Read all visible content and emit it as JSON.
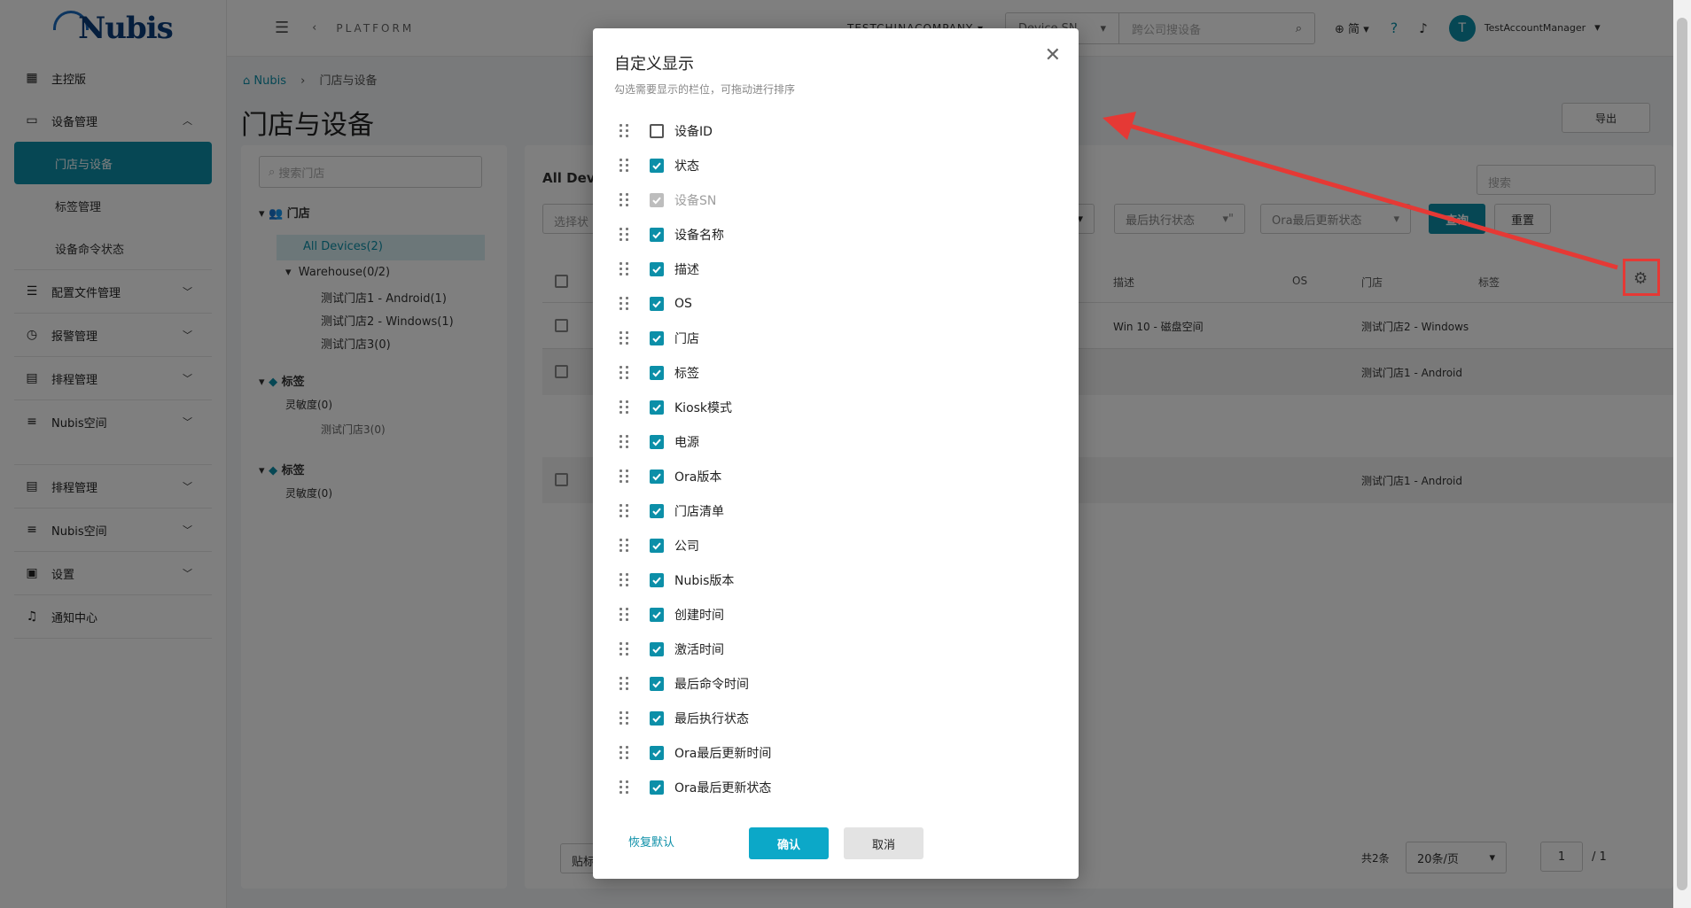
{
  "sidebar": {
    "logo": "Nubis",
    "items": [
      {
        "label": "主控版",
        "icon": "dashboard-icon"
      },
      {
        "label": "设备管理",
        "icon": "devices-icon"
      },
      {
        "label": "门店与设备"
      },
      {
        "label": "标签管理"
      },
      {
        "label": "设备命令状态"
      },
      {
        "label": "配置文件管理",
        "icon": "config-file-icon"
      },
      {
        "label": "报警管理",
        "icon": "alarm-icon"
      },
      {
        "label": "排程管理",
        "icon": "calendar-icon"
      },
      {
        "label": "Nubis空间",
        "icon": "list-icon"
      },
      {
        "label": "排程管理",
        "icon": "calendar-icon"
      },
      {
        "label": "Nubis空间",
        "icon": "list-icon"
      },
      {
        "label": "设置",
        "icon": "settings-doc-icon"
      },
      {
        "label": "通知中心",
        "icon": "bell-icon"
      }
    ]
  },
  "topbar": {
    "platform": "PLATFORM",
    "company": "TESTCHINACOMPANY",
    "search_type": "Device SN",
    "search_placeholder": "跨公司搜设备",
    "lang": "简",
    "user": "TestAccountManager",
    "avatar_letter": "T"
  },
  "main": {
    "breadcrumb_home": "Nubis",
    "breadcrumb_current": "门店与设备",
    "title": "门店与设备",
    "export": "导出",
    "store_search_placeholder": "搜索门店",
    "tree": {
      "root": "门店",
      "all": "All Devices(2)",
      "warehouse": "Warehouse(0/2)",
      "store1": "测试门店1 - Android(1)",
      "store2": "测试门店2 - Windows(1)",
      "store3": "测试门店3(0)",
      "tags": "标签",
      "sensitivity": "灵敏度(0)",
      "store3_dup": "测试门店3(0)",
      "tags2": "标签",
      "sensitivity2": "灵敏度(0)"
    },
    "table": {
      "title": "All Devi",
      "filter_placeholder": "选择状",
      "filter_last_exec": "最后执行状态",
      "filter_ora": "Ora最后更新状态",
      "search_placeholder": "搜索",
      "query": "查询",
      "reset": "重置",
      "col_desc": "描述",
      "col_os": "OS",
      "col_store": "门店",
      "col_tag": "标签",
      "row1_desc": "Win 10 - 磁盘空间",
      "row1_store": "测试门店2 - Windows",
      "row2_store": "测试门店1 - Android",
      "row3_store": "测试门店1 - Android",
      "total": "共2条",
      "page_size": "20条/页",
      "page": "1",
      "pages": "/ 1",
      "bottom_btn": "贴标"
    }
  },
  "modal": {
    "title": "自定义显示",
    "subtitle": "勾选需要显示的栏位，可拖动进行排序",
    "columns": [
      {
        "label": "设备ID",
        "state": "off"
      },
      {
        "label": "状态",
        "state": "on"
      },
      {
        "label": "设备SN",
        "state": "dis"
      },
      {
        "label": "设备名称",
        "state": "on"
      },
      {
        "label": "描述",
        "state": "on"
      },
      {
        "label": "OS",
        "state": "on"
      },
      {
        "label": "门店",
        "state": "on"
      },
      {
        "label": "标签",
        "state": "on"
      },
      {
        "label": "Kiosk模式",
        "state": "on"
      },
      {
        "label": "电源",
        "state": "on"
      },
      {
        "label": "Ora版本",
        "state": "on"
      },
      {
        "label": "门店清单",
        "state": "on"
      },
      {
        "label": "公司",
        "state": "on"
      },
      {
        "label": "Nubis版本",
        "state": "on"
      },
      {
        "label": "创建时间",
        "state": "on"
      },
      {
        "label": "激活时间",
        "state": "on"
      },
      {
        "label": "最后命令时间",
        "state": "on"
      },
      {
        "label": "最后执行状态",
        "state": "on"
      },
      {
        "label": "Ora最后更新时间",
        "state": "on"
      },
      {
        "label": "Ora最后更新状态",
        "state": "on"
      }
    ],
    "reset_default": "恢复默认",
    "confirm": "确认",
    "cancel": "取消"
  },
  "colors": {
    "accent": "#0c8fa8",
    "annotation": "#e53935"
  }
}
